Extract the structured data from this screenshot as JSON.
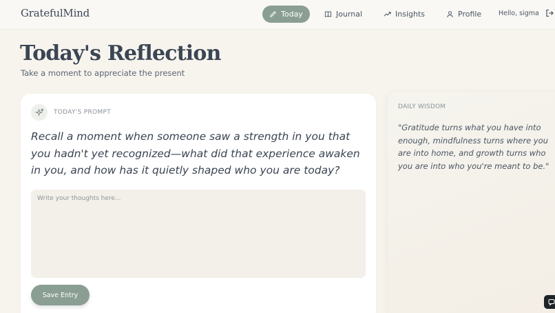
{
  "nav": {
    "logo": "GratefulMind",
    "items": [
      {
        "label": "Today",
        "icon": "pencil-icon",
        "active": true
      },
      {
        "label": "Journal",
        "icon": "book-icon",
        "active": false
      },
      {
        "label": "Insights",
        "icon": "trend-icon",
        "active": false
      },
      {
        "label": "Profile",
        "icon": "user-icon",
        "active": false
      }
    ],
    "greeting": "Hello, sigma",
    "logout_icon": "logout-icon"
  },
  "header": {
    "title": "Today's Reflection",
    "subtitle": "Take a moment to appreciate the present"
  },
  "prompt_card": {
    "label": "TODAY'S PROMPT",
    "icon": "sparkle-icon",
    "prompt": "Recall a moment when someone saw a strength in you that you hadn't yet recognized—what did that experience awaken in you, and how has it quietly shaped who you are today?",
    "input_placeholder": "Write your thoughts here...",
    "input_value": "",
    "save_label": "Save Entry"
  },
  "wisdom": {
    "label": "DAILY WISDOM",
    "quote": "\"Gratitude turns what you have into enough, mindfulness turns where you are into home, and growth turns who you are into who you're meant to be.\""
  },
  "colors": {
    "accent": "#8a9e94",
    "background": "#f7f4ee",
    "text": "#3a4452"
  }
}
